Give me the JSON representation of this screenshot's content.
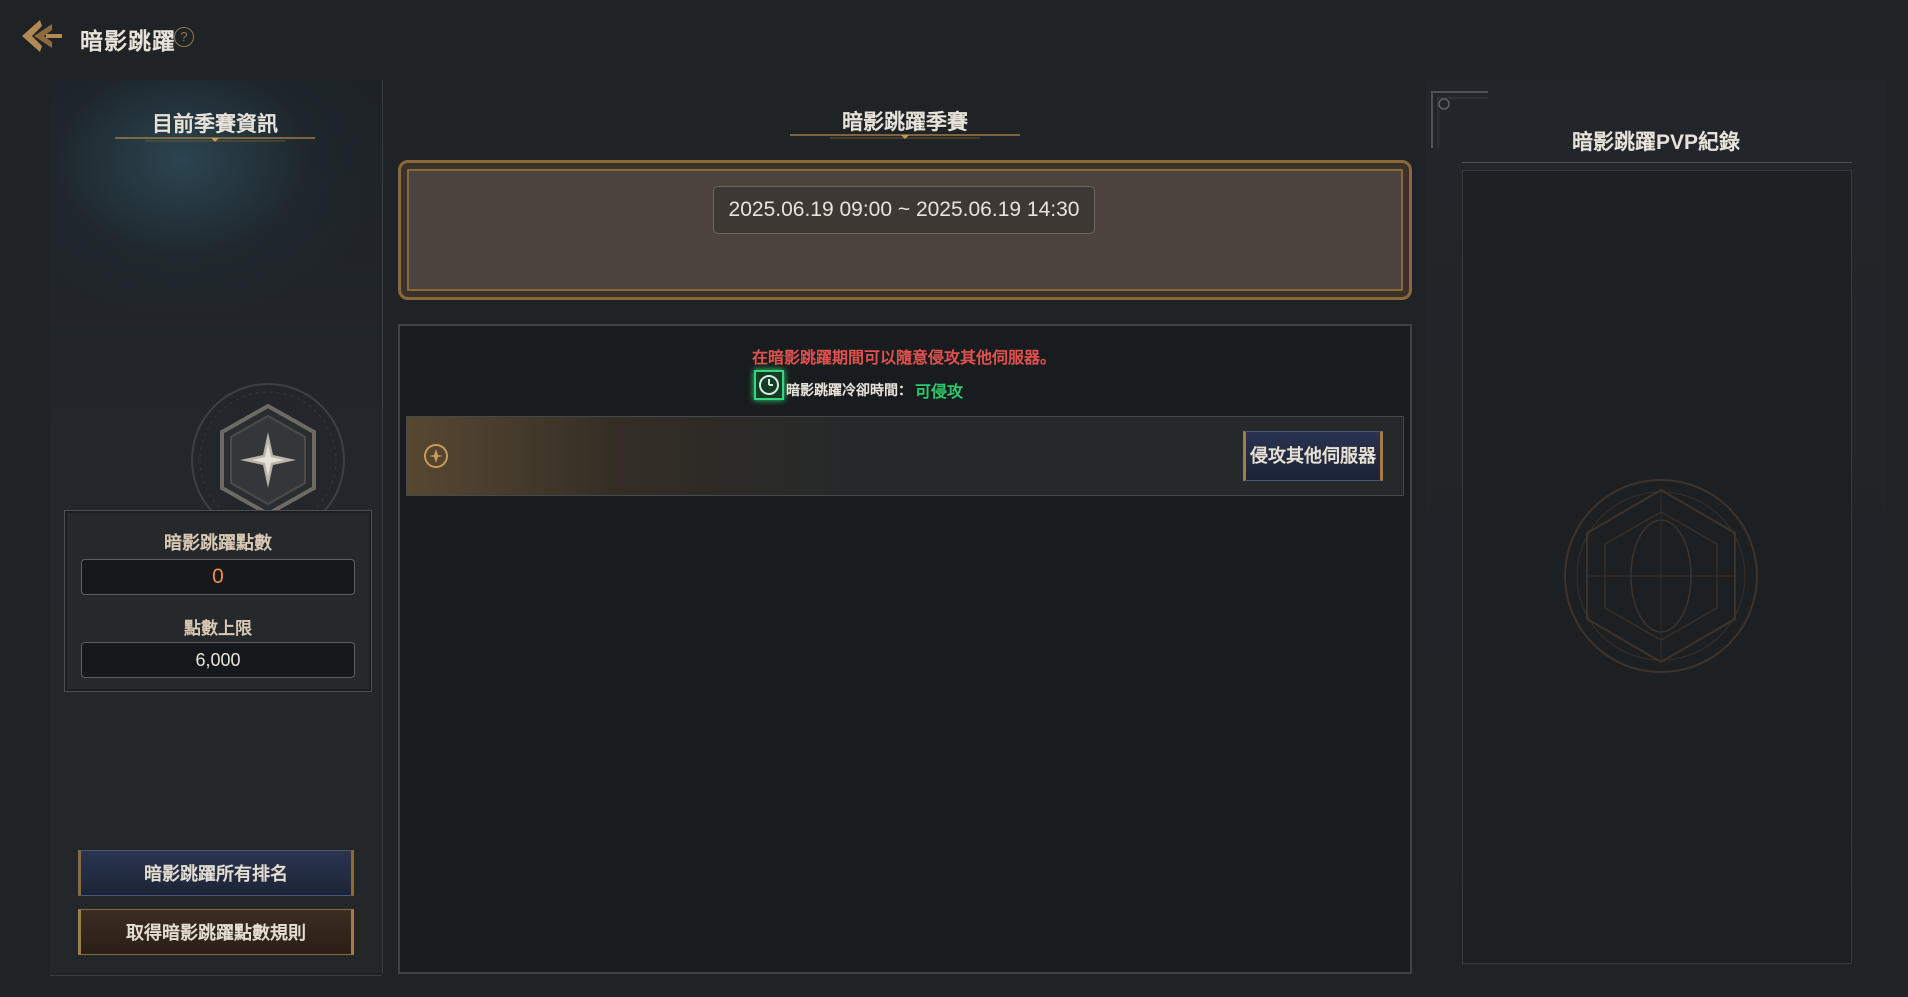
{
  "header": {
    "title": "暗影跳躍",
    "help_icon": "question-circle-icon",
    "back_icon": "back-arrow-icon"
  },
  "left_panel": {
    "title": "目前季賽資訊",
    "points_label": "暗影跳躍點數",
    "points_value": "0",
    "limit_label": "點數上限",
    "limit_value": "6,000",
    "ranking_button": "暗影跳躍所有排名",
    "rules_button": "取得暗影跳躍點數規則"
  },
  "center": {
    "title": "暗影跳躍季賽",
    "season_period": "2025.06.19 09:00 ~ 2025.06.19 14:30",
    "notice": "在暗影跳躍期間可以隨意侵攻其他伺服器。",
    "cooldown_label": "暗影跳躍冷卻時間：",
    "cooldown_status": "可侵攻",
    "invade_button": "侵攻其他伺服器"
  },
  "right_panel": {
    "title": "暗影跳躍PVP紀錄"
  },
  "colors": {
    "accent_gold": "#8a6938",
    "points_orange": "#f08c4a",
    "notice_red": "#e0514f",
    "status_green": "#2ec86a"
  }
}
